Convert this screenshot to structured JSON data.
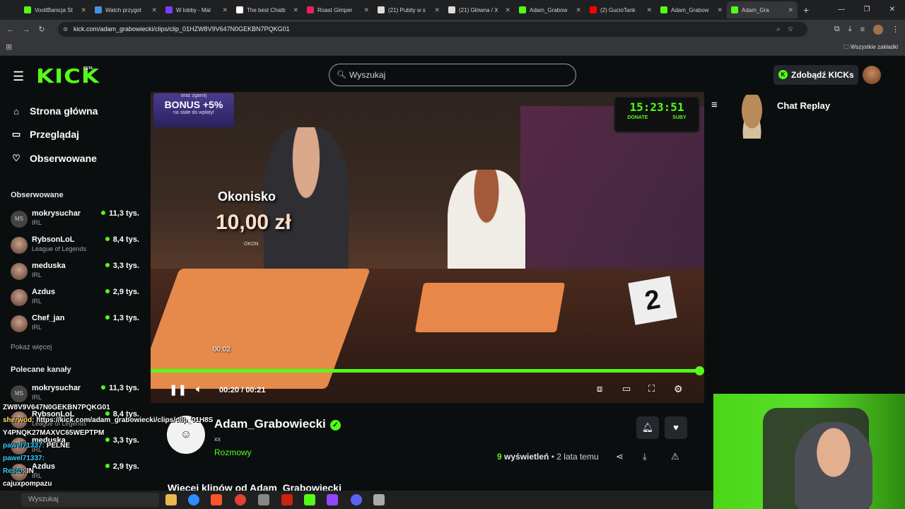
{
  "browser": {
    "tabs": [
      {
        "label": "VooltBanicja St",
        "color": "#53fc18"
      },
      {
        "label": "Watch przygot",
        "color": "#4a90e2"
      },
      {
        "label": "W lobby - Mal",
        "color": "#7a3cff"
      },
      {
        "label": "The best Chatb",
        "color": "#ffffff"
      },
      {
        "label": "Roast Gimper",
        "color": "#e0245e"
      },
      {
        "label": "(21) Pubity w s",
        "color": "#dddddd"
      },
      {
        "label": "(21) Główna / X",
        "color": "#dddddd"
      },
      {
        "label": "Adam_Grabow",
        "color": "#53fc18"
      },
      {
        "label": "(2) GucioTank",
        "color": "#ff0000"
      },
      {
        "label": "Adam_Grabow",
        "color": "#53fc18"
      },
      {
        "label": "Adam_Gra",
        "color": "#53fc18"
      }
    ],
    "url": "kick.com/adam_grabowiecki/clips/clip_01HZW8V9V647N0GEKBN7PQKG01",
    "all_bookmarks": "Wszystkie zakładki"
  },
  "header": {
    "logo": "KICK",
    "beta": "BETA",
    "search_placeholder": "Wyszukaj",
    "get_kicks": "Zdobądź KICKs"
  },
  "sidebar": {
    "nav": [
      {
        "label": "Strona główna",
        "icon": "home-icon"
      },
      {
        "label": "Przeglądaj",
        "icon": "browse-icon"
      },
      {
        "label": "Obserwowane",
        "icon": "heart-icon"
      }
    ],
    "followed_title": "Obserwowane",
    "followed": [
      {
        "name": "mokrysuchar",
        "category": "IRL",
        "viewers": "11,3 tys.",
        "initials": "MS"
      },
      {
        "name": "RybsonLoL",
        "category": "League of Legends",
        "viewers": "8,4 tys.",
        "initials": ""
      },
      {
        "name": "meduska",
        "category": "IRL",
        "viewers": "3,3 tys.",
        "initials": ""
      },
      {
        "name": "Azdus",
        "category": "IRL",
        "viewers": "2,9 tys.",
        "initials": ""
      },
      {
        "name": "Chef_jan",
        "category": "IRL",
        "viewers": "1,3 tys.",
        "initials": ""
      }
    ],
    "show_more": "Pokaż więcej",
    "recommended_title": "Polecane kanały",
    "recommended": [
      {
        "name": "mokrysuchar",
        "category": "IRL",
        "viewers": "11,3 tys.",
        "initials": "MS"
      },
      {
        "name": "RybsonLoL",
        "category": "League of Legends",
        "viewers": "8,4 tys.",
        "initials": ""
      },
      {
        "name": "meduska",
        "category": "IRL",
        "viewers": "3,3 tys.",
        "initials": ""
      },
      {
        "name": "Azdus",
        "category": "IRL",
        "viewers": "2,9 tys.",
        "initials": ""
      }
    ]
  },
  "video": {
    "bonus_top": "oraz zgarnij",
    "bonus": "BONUS +5%",
    "bonus_sub": "na stałe do wpłaty!",
    "timer": "15:23:51",
    "donate": "DONATE",
    "suby": "SUBY",
    "overlay_title": "Okonisko",
    "overlay_price": "10,00 zł",
    "overlay_sub": "OKON",
    "sign_number": "2",
    "hover_time": "00:02",
    "current_time": "00:20",
    "duration": "00:21",
    "progress_fraction": 0.95
  },
  "channel": {
    "name": "Adam_Grabowiecki",
    "tagline": "xx",
    "category": "Rozmowy",
    "views_count": "9",
    "views_label": "wyświetleń",
    "age": "2 lata temu",
    "more_clips": "Więcej klipów od Adam_Grabowiecki"
  },
  "chat": {
    "title": "Chat Replay"
  },
  "stream_chat_overlay": [
    {
      "user": "",
      "text": "ZW8V9V647N0GEKBN7PQKG01"
    },
    {
      "user": "sherwod:",
      "text": "https://kick.com/adam_grabowiecki/clips/clip_01H8S"
    },
    {
      "user": "",
      "text": "Y4PNQK27MAXVC65WEPTPM"
    },
    {
      "user": "pawel71337:",
      "text": "PELNE"
    },
    {
      "user": "pawel71337:",
      "text": ""
    },
    {
      "user": "Resto:",
      "text": "IN"
    },
    {
      "user": "",
      "text": "cajuxpompazu"
    }
  ],
  "taskbar": {
    "search": "Wyszukaj"
  }
}
